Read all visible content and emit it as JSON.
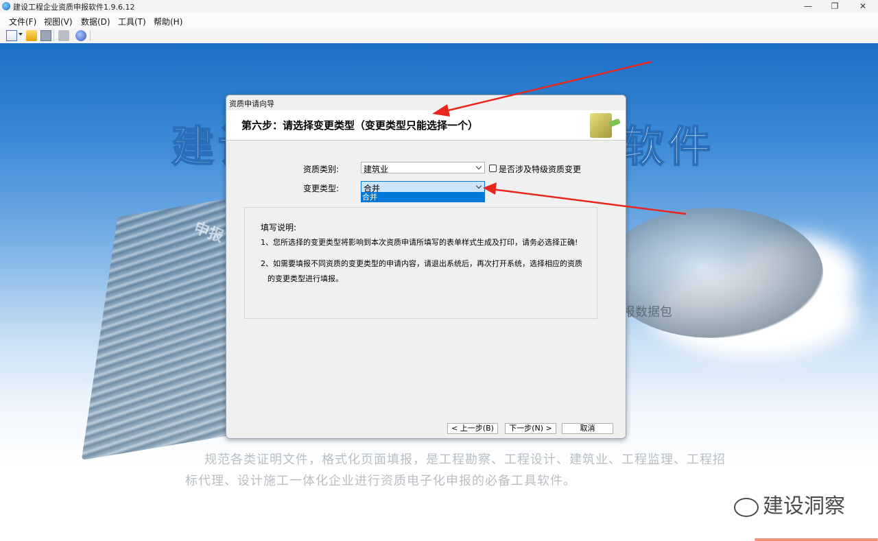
{
  "window": {
    "title": "建设工程企业资质申报软件1.9.6.12",
    "minimize": "—",
    "restore": "❐",
    "close": "✕"
  },
  "menu": [
    "文件(F)",
    "视图(V)",
    "数据(D)",
    "工具(T)",
    "帮助(H)"
  ],
  "toolbar_icons": [
    "new-icon",
    "open-folder-icon",
    "save-icon",
    "print-icon",
    "web-icon"
  ],
  "background": {
    "title_left": "建设",
    "title_right": "软件",
    "stamp": "申报",
    "package": "报数据包",
    "desc_line1": "规范各类证明文件，格式化页面填报，是工程勘察、工程设计、建筑业、工程监理、工程招",
    "desc_line2": "标代理、设计施工一体化企业进行资质电子化申报的必备工具软件。",
    "watermark": "建设洞察"
  },
  "dialog": {
    "title": "资质申请向导",
    "step_title": "第六步：请选择变更类型（变更类型只能选择一个）",
    "qual_category_label": "资质类别:",
    "qual_category_value": "建筑业",
    "special_checkbox_label": "是否涉及特级资质变更",
    "change_type_label": "变更类型:",
    "change_type_value": "合并",
    "change_type_options": [
      "合并"
    ],
    "notes_title": "填写说明:",
    "note1": "1、您所选择的变更类型将影响到本次资质申请所填写的表单样式生成及打印，请务必选择正确!",
    "note2_a": "2、如需要填报不同资质的变更类型的申请内容，请退出系统后，再次打开系统，选择相应的资质",
    "note2_b": "的变更类型进行填报。",
    "btn_prev": "< 上一步(B)",
    "btn_next": "下一步(N) >",
    "btn_cancel": "取消"
  },
  "colors": {
    "accent": "#0078d7",
    "arrow": "#e8261c",
    "bg_top": "#1c6fc7"
  }
}
